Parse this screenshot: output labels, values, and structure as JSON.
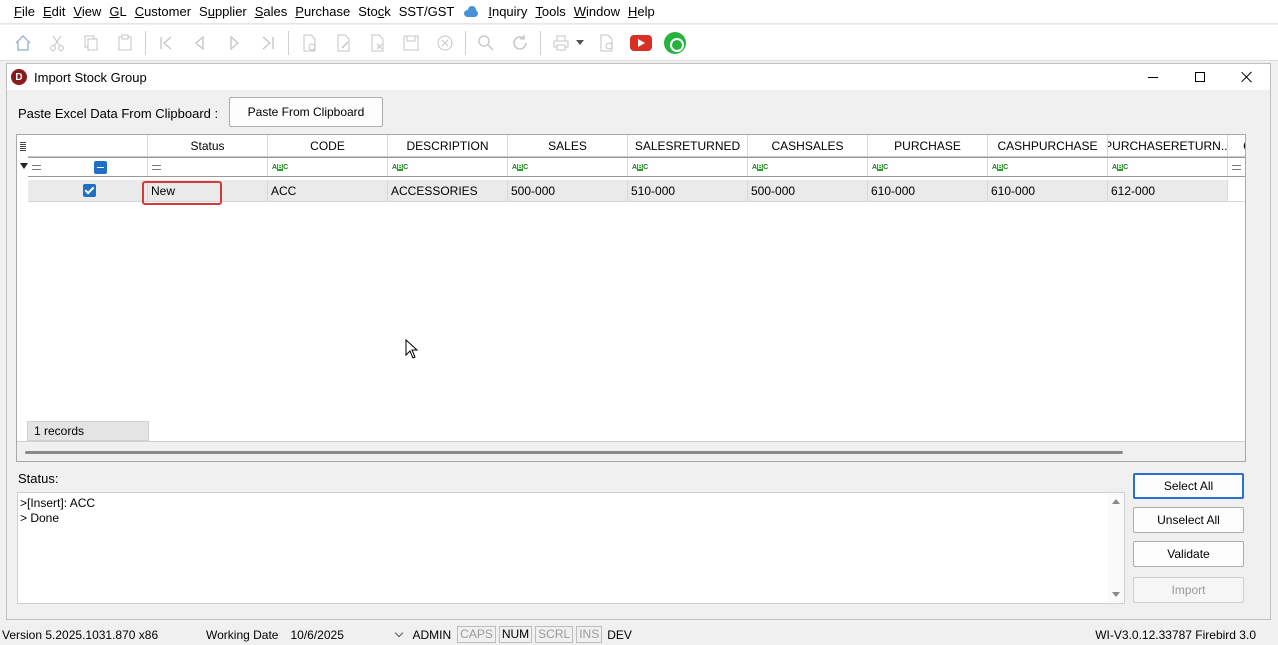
{
  "menu": [
    {
      "label": "File",
      "u": 0
    },
    {
      "label": "Edit",
      "u": 0
    },
    {
      "label": "View",
      "u": 0
    },
    {
      "label": "GL",
      "u": 0
    },
    {
      "label": "Customer",
      "u": 0
    },
    {
      "label": "Supplier",
      "u": 1
    },
    {
      "label": "Sales",
      "u": 0
    },
    {
      "label": "Purchase",
      "u": 0
    },
    {
      "label": "Stock",
      "u": 3
    },
    {
      "label": "SST/GST",
      "u": -1
    },
    {
      "label": "Inquiry",
      "u": 0
    },
    {
      "label": "Tools",
      "u": 0
    },
    {
      "label": "Window",
      "u": 0
    },
    {
      "label": "Help",
      "u": 0
    }
  ],
  "window": {
    "title": "Import Stock Group"
  },
  "paste": {
    "label": "Paste Excel Data From Clipboard :",
    "button": "Paste From Clipboard"
  },
  "grid": {
    "columns": [
      "",
      "Status",
      "CODE",
      "DESCRIPTION",
      "SALES",
      "SALESRETURNED",
      "CASHSALES",
      "PURCHASE",
      "CASHPURCHASE",
      "PURCHASERETURN...",
      "C"
    ],
    "rows": [
      {
        "selected": true,
        "status": "New",
        "code": "ACC",
        "description": "ACCESSORIES",
        "sales": "500-000",
        "salesreturned": "510-000",
        "cashsales": "500-000",
        "purchase": "610-000",
        "cashpurchase": "610-000",
        "purchasereturned": "612-000"
      }
    ],
    "footer": "1 records"
  },
  "status": {
    "label": "Status:",
    "lines": [
      ">[Insert]: ACC",
      "> Done"
    ]
  },
  "buttons": {
    "select_all": "Select All",
    "unselect_all": "Unselect All",
    "validate": "Validate",
    "import": "Import"
  },
  "statusbar": {
    "version": "Version 5.2025.1031.870 x86",
    "working_date_label": "Working Date",
    "working_date": "10/6/2025",
    "user": "ADMIN",
    "caps": "CAPS",
    "num": "NUM",
    "scrl": "SCRL",
    "ins": "INS",
    "mode": "DEV",
    "db": "WI-V3.0.12.33787 Firebird 3.0"
  },
  "icons": {
    "youtube_color": "#d93025",
    "whatsapp_color": "#25b33e",
    "accent": "#2a6fca",
    "highlight": "#d33a3a"
  }
}
